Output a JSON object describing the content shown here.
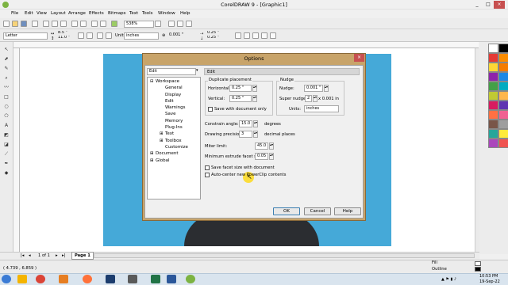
{
  "window": {
    "title": "CorelDRAW 9 - [Graphic1]",
    "minimize": "_",
    "maximize": "□",
    "close": "×"
  },
  "menu": [
    "File",
    "Edit",
    "View",
    "Layout",
    "Arrange",
    "Effects",
    "Bitmaps",
    "Text",
    "Tools",
    "Window",
    "Help"
  ],
  "toolbar": {
    "zoom": "538%"
  },
  "propbar": {
    "paper": "Letter",
    "width": "8.5 \"",
    "height": "11.0 \"",
    "units": "inches",
    "nudge": "0.001 \"",
    "dup_h": "0.25 \"",
    "dup_v": "0.25 \""
  },
  "dialog": {
    "title": "Options",
    "category": "Edit",
    "section_header": "Edit",
    "tree": [
      {
        "prefix": "⊟",
        "label": "Workspace",
        "indent": 0
      },
      {
        "prefix": "",
        "label": "General",
        "indent": 1
      },
      {
        "prefix": "",
        "label": "Display",
        "indent": 1
      },
      {
        "prefix": "",
        "label": "Edit",
        "indent": 1
      },
      {
        "prefix": "",
        "label": "Warnings",
        "indent": 1
      },
      {
        "prefix": "",
        "label": "Save",
        "indent": 1
      },
      {
        "prefix": "",
        "label": "Memory",
        "indent": 1
      },
      {
        "prefix": "",
        "label": "Plug-Ins",
        "indent": 1
      },
      {
        "prefix": "⊞",
        "label": "Text",
        "indent": 1
      },
      {
        "prefix": "⊞",
        "label": "Toolbox",
        "indent": 1
      },
      {
        "prefix": "",
        "label": "Customize",
        "indent": 1
      },
      {
        "prefix": "⊞",
        "label": "Document",
        "indent": 0
      },
      {
        "prefix": "⊞",
        "label": "Global",
        "indent": 0
      }
    ],
    "duplicate": {
      "title": "Duplicate placement",
      "horizontal_label": "Horizontal:",
      "horizontal": "0.25 \"",
      "vertical_label": "Vertical:",
      "vertical": "0.25 \"",
      "save_with_doc": "Save with document only"
    },
    "nudge": {
      "title": "Nudge",
      "nudge_label": "Nudge:",
      "nudge": "0.001 \"",
      "super_label": "Super nudge:",
      "super": "2",
      "super_suffix": "x 0.001 in",
      "units_label": "Units:",
      "units": "inches"
    },
    "constrain_label": "Constrain angle:",
    "constrain": "15.0",
    "constrain_unit": "degrees",
    "precision_label": "Drawing precision:",
    "precision": "3",
    "precision_unit": "decimal places",
    "miter_label": "Miter limit:",
    "miter": "45.0",
    "extrude_label": "Minimum extrude facet size:",
    "extrude": "0.05 \"",
    "chk_facet": "Save facet size with document",
    "chk_powerclip": "Auto-center new PowerClip contents",
    "ok": "OK",
    "cancel": "Cancel",
    "help": "Help"
  },
  "pagebar": {
    "count": "1 of 1",
    "tab": "Page 1"
  },
  "status": {
    "coords": "( 4.739 , 6.859 )",
    "fill_label": "Fill",
    "outline_label": "Outline"
  },
  "taskbar": {
    "time": "10:53 PM",
    "date": "19-Sep-22"
  },
  "colors": {
    "photo_bg": "#45a9d8",
    "dialog_frame": "#c8a46a",
    "palette": [
      "#ffffff",
      "#000000",
      "#e53935",
      "#fb8c00",
      "#fdd835",
      "#f57c00",
      "#8e24aa",
      "#1e88e5",
      "#43a047",
      "#00acc1",
      "#c0ca33",
      "#ffb74d",
      "#d81b60",
      "#5e35b1",
      "#ff7043",
      "#f06292",
      "#795548",
      "#9e9e9e",
      "#26a69a",
      "#ffeb3b",
      "#ab47bc",
      "#ef5350"
    ]
  }
}
